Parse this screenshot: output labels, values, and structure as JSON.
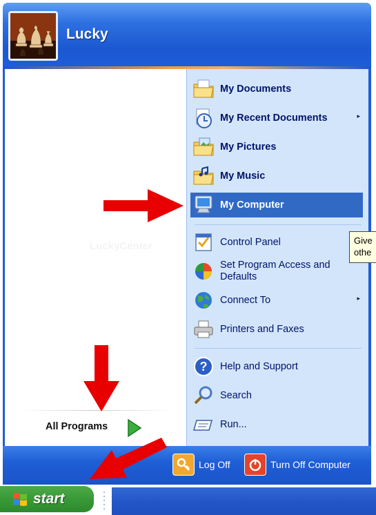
{
  "header": {
    "username": "Lucky"
  },
  "watermark": "LuckyCenter",
  "right_items": [
    {
      "label": "My Documents",
      "icon": "folder-documents-icon"
    },
    {
      "label": "My Recent Documents",
      "icon": "recent-documents-icon",
      "submenu": "▸"
    },
    {
      "label": "My Pictures",
      "icon": "folder-pictures-icon"
    },
    {
      "label": "My Music",
      "icon": "folder-music-icon"
    },
    {
      "label": "My Computer",
      "icon": "computer-icon"
    },
    {
      "label": "Control Panel",
      "icon": "control-panel-icon"
    },
    {
      "label": "Set Program Access and Defaults",
      "line1": "Set Program Access and",
      "line2": "Defaults",
      "icon": "program-access-icon"
    },
    {
      "label": "Connect To",
      "icon": "connect-globe-icon",
      "submenu": "▸"
    },
    {
      "label": "Printers and Faxes",
      "icon": "printer-icon"
    },
    {
      "label": "Help and Support",
      "icon": "help-icon"
    },
    {
      "label": "Search",
      "icon": "search-icon"
    },
    {
      "label": "Run...",
      "icon": "run-icon"
    }
  ],
  "all_programs": {
    "label": "All Programs"
  },
  "footer": {
    "log_off": "Log Off",
    "turn_off": "Turn Off Computer"
  },
  "taskbar": {
    "start": "start"
  },
  "tooltip": {
    "line1": "Give",
    "line2": "othe"
  },
  "colors": {
    "menu_blue": "#1e5ed8",
    "selection": "#316ac5",
    "right_pane": "#d3e5fa",
    "start_green": "#3c9d3a",
    "arrow_red": "#e80000"
  }
}
